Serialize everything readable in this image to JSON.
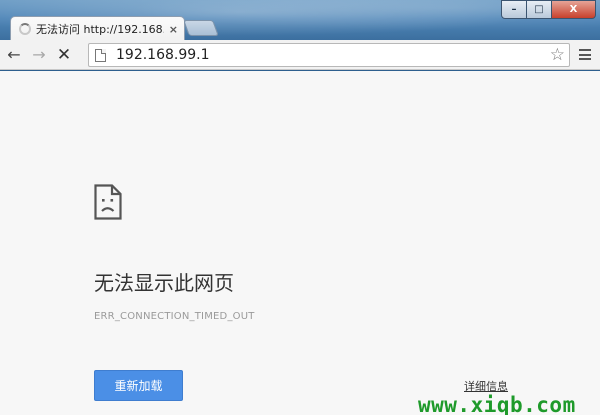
{
  "tab": {
    "title": "无法访问 http://192.168.",
    "close_symbol": "×"
  },
  "window_controls": {
    "minimize": "–",
    "maximize": "□",
    "close": "X"
  },
  "toolbar": {
    "back_symbol": "←",
    "forward_symbol": "→",
    "stop_symbol": "✕",
    "url": "192.168.99.1",
    "star_symbol": "☆"
  },
  "error_page": {
    "heading": "无法显示此网页",
    "error_code": "ERR_CONNECTION_TIMED_OUT",
    "reload_button": "重新加载",
    "details_link": "详细信息"
  },
  "watermark": "www.xiqb.com",
  "colors": {
    "reload_button": "#4b8fe6",
    "watermark": "#1e9a2a",
    "page_background": "#f7f7f7"
  },
  "icons": {
    "tab_spinner": "loading-spinner-icon",
    "page": "page-icon",
    "error": "sad-page-icon",
    "menu": "menu-icon"
  }
}
